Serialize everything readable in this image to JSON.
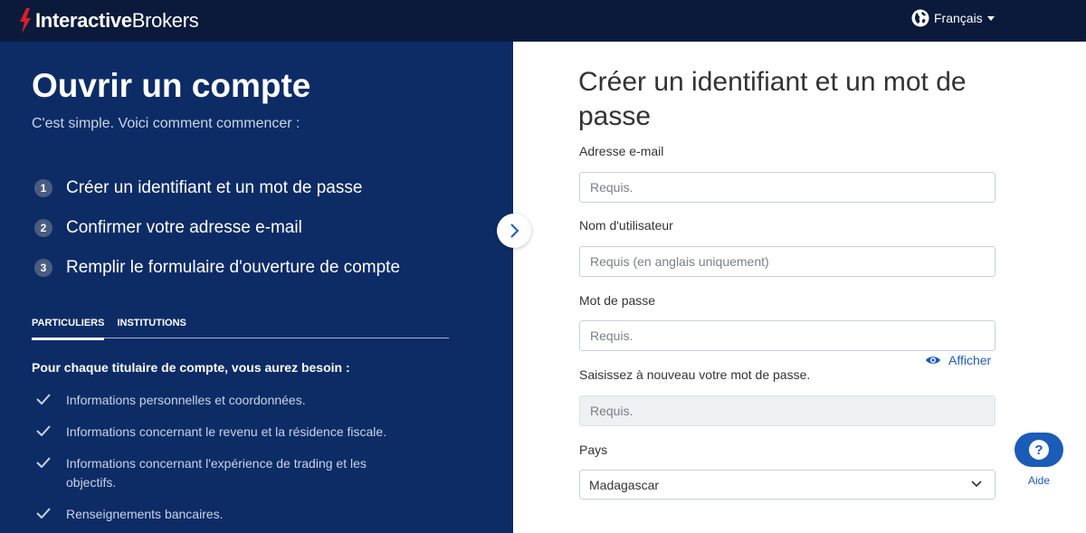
{
  "header": {
    "logo_bold": "Interactive",
    "logo_light": "Brokers",
    "language": "Français"
  },
  "left": {
    "title": "Ouvrir un compte",
    "subtitle": "C'est simple. Voici comment commencer :",
    "steps": [
      {
        "num": "1",
        "label": "Créer un identifiant et un mot de passe"
      },
      {
        "num": "2",
        "label": "Confirmer votre adresse e-mail"
      },
      {
        "num": "3",
        "label": "Remplir le formulaire d'ouverture de compte"
      }
    ],
    "tabs": [
      {
        "label": "PARTICULIERS",
        "active": true
      },
      {
        "label": "INSTITUTIONS",
        "active": false
      }
    ],
    "requirements_title": "Pour chaque titulaire de compte, vous aurez besoin :",
    "requirements": [
      "Informations personnelles et coordonnées.",
      "Informations concernant le revenu et la résidence fiscale.",
      "Informations concernant l'expérience de trading et les objectifs.",
      "Renseignements bancaires."
    ]
  },
  "form": {
    "title": "Créer un identifiant et un mot de passe",
    "email_label": "Adresse e-mail",
    "email_placeholder": "Requis.",
    "username_label": "Nom d'utilisateur",
    "username_placeholder": "Requis (en anglais uniquement)",
    "password_label": "Mot de passe",
    "password_placeholder": "Requis.",
    "show_password": "Afficher",
    "confirm_label": "Saisissez à nouveau votre mot de passe.",
    "confirm_placeholder": "Requis.",
    "country_label": "Pays",
    "country_value": "Madagascar"
  },
  "help": {
    "icon_text": "?",
    "label": "Aide"
  },
  "colors": {
    "topbar": "#0b1a3b",
    "left_panel": "#0d2c66",
    "accent_blue": "#1a5cb8",
    "logo_red": "#d81f26"
  }
}
